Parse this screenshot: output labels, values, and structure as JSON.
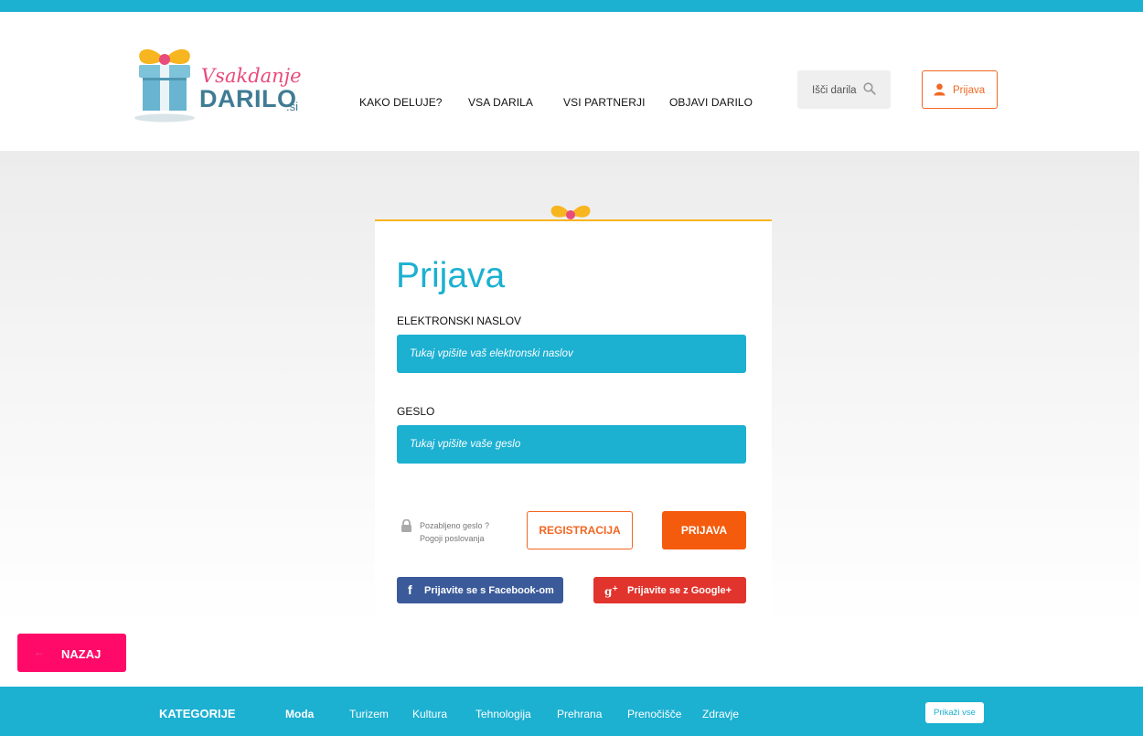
{
  "header": {
    "logo": {
      "script": "Vsakdanje",
      "main": "DARILO",
      "suffix": ".si"
    },
    "nav": [
      {
        "label": "KAKO DELUJE?"
      },
      {
        "label": "VSA DARILA"
      },
      {
        "label": "VSI PARTNERJI"
      },
      {
        "label": "OBJAVI DARILO"
      }
    ],
    "search": {
      "placeholder": "Išči darila",
      "icon": "search-icon"
    },
    "login": {
      "label": "Prijava",
      "icon": "user-icon"
    }
  },
  "login_form": {
    "title": "Prijava",
    "email": {
      "label": "ELEKTRONSKI NASLOV",
      "placeholder": "Tukaj vpišite vaš elektronski naslov",
      "value": ""
    },
    "password": {
      "label": "GESLO",
      "placeholder": "Tukaj vpišite vaše geslo",
      "value": ""
    },
    "forgot_password": "Pozabljeno geslo ?",
    "terms": "Pogoji poslovanja",
    "register_label": "REGISTRACIJA",
    "submit_label": "PRIJAVA",
    "facebook_label": "Prijavite se s Facebook-om",
    "google_label": "Prijavite se z Google+"
  },
  "back_button": {
    "label": "NAZAJ",
    "icon": "arrow-left-icon"
  },
  "footer": {
    "title": "KATEGORIJE",
    "categories": [
      {
        "label": "Moda"
      },
      {
        "label": "Turizem"
      },
      {
        "label": "Kultura"
      },
      {
        "label": "Tehnologija"
      },
      {
        "label": "Prehrana"
      },
      {
        "label": "Prenočišče"
      },
      {
        "label": "Zdravje"
      }
    ],
    "show_all": "Prikaži vse"
  },
  "colors": {
    "brand_blue": "#1cb0d1",
    "brand_orange": "#f26722",
    "brand_pink": "#ff0a68",
    "facebook": "#3b5a9a",
    "google": "#e0342c",
    "ribbon": "#f7b520"
  }
}
